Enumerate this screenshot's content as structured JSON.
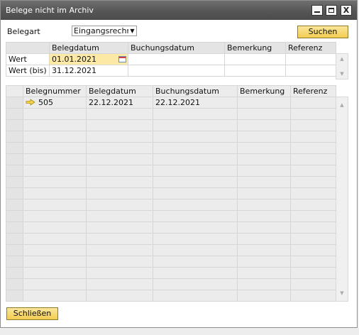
{
  "window": {
    "title": "Belege nicht im Archiv",
    "close_glyph": "X"
  },
  "filter": {
    "belegart_label": "Belegart",
    "belegart_value": "Eingangsrechnu",
    "search_label": "Suchen"
  },
  "criteria": {
    "columns": [
      "",
      "Belegdatum",
      "Buchungsdatum",
      "Bemerkung",
      "Referenz"
    ],
    "rows": [
      {
        "label": "Wert",
        "belegdatum": "01.01.2021",
        "buchungsdatum": "",
        "bemerkung": "",
        "referenz": ""
      },
      {
        "label": "Wert (bis)",
        "belegdatum": "31.12.2021",
        "buchungsdatum": "",
        "bemerkung": "",
        "referenz": ""
      }
    ]
  },
  "results": {
    "columns": [
      "",
      "Belegnummer",
      "Belegdatum",
      "Buchungsdatum",
      "Bemerkung",
      "Referenz"
    ],
    "rows": [
      {
        "belegnummer": "505",
        "belegdatum": "22.12.2021",
        "buchungsdatum": "22.12.2021",
        "bemerkung": "",
        "referenz": ""
      }
    ],
    "row_link_icon": "yellow-arrow-icon"
  },
  "footer": {
    "close_label": "Schließen"
  },
  "colors": {
    "button_fill": "#f3cd52",
    "highlight_field": "#fde9a6",
    "titlebar": "#565656"
  }
}
